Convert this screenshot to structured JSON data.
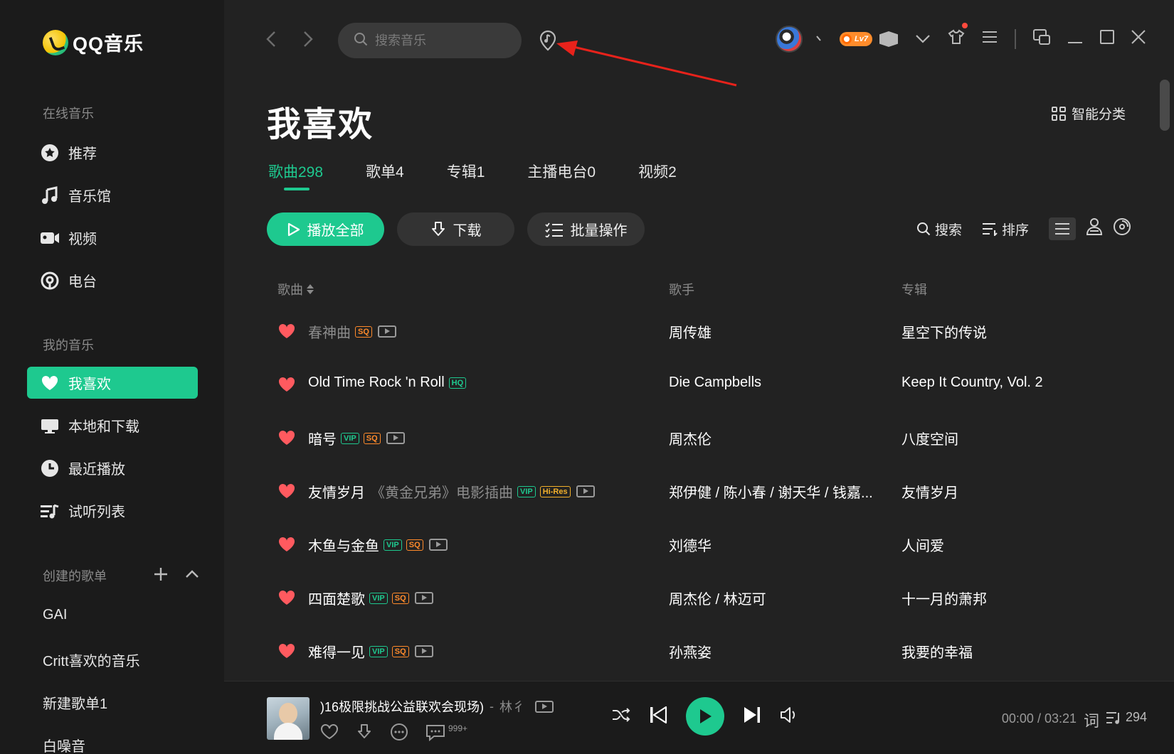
{
  "app": {
    "name": "QQ音乐"
  },
  "sidebar": {
    "online_title": "在线音乐",
    "online_items": [
      {
        "label": "推荐",
        "icon": "star-icon"
      },
      {
        "label": "音乐馆",
        "icon": "music-note-icon"
      },
      {
        "label": "视频",
        "icon": "video-camera-icon"
      },
      {
        "label": "电台",
        "icon": "radio-icon"
      }
    ],
    "my_title": "我的音乐",
    "my_items": [
      {
        "label": "我喜欢",
        "icon": "heart-icon",
        "active": true
      },
      {
        "label": "本地和下载",
        "icon": "monitor-icon"
      },
      {
        "label": "最近播放",
        "icon": "clock-icon"
      },
      {
        "label": "试听列表",
        "icon": "playlist-icon"
      }
    ],
    "created_title": "创建的歌单",
    "playlists": [
      "GAI",
      "Critt喜欢的音乐",
      "新建歌单1",
      "白噪音"
    ]
  },
  "topbar": {
    "search_placeholder": "搜索音乐",
    "level_badge": "Lv7"
  },
  "page": {
    "title": "我喜欢",
    "smart_category": "智能分类",
    "tabs": [
      "歌曲298",
      "歌单4",
      "专辑1",
      "主播电台0",
      "视频2"
    ],
    "active_tab": 0,
    "buttons": {
      "play_all": "播放全部",
      "download": "下载",
      "batch": "批量操作"
    },
    "tools": {
      "search": "搜索",
      "sort": "排序"
    }
  },
  "table": {
    "headers": {
      "song": "歌曲",
      "artist": "歌手",
      "album": "专辑"
    },
    "rows": [
      {
        "title": "春神曲",
        "subtitle": "",
        "tags": [
          "SQ"
        ],
        "mv": true,
        "artist": "周传雄",
        "album": "星空下的传说",
        "dim": true
      },
      {
        "title": "Old Time Rock 'n Roll",
        "subtitle": "",
        "tags": [
          "HQ"
        ],
        "mv": false,
        "artist": "Die Campbells",
        "album": "Keep It Country, Vol. 2",
        "dim": false
      },
      {
        "title": "暗号",
        "subtitle": "",
        "tags": [
          "VIP",
          "SQ"
        ],
        "mv": true,
        "artist": "周杰伦",
        "album": "八度空间",
        "dim": false
      },
      {
        "title": "友情岁月",
        "subtitle": "《黄金兄弟》电影插曲",
        "tags": [
          "VIP",
          "Hi-Res"
        ],
        "mv": true,
        "artist": "郑伊健 / 陈小春 / 谢天华 / 钱嘉...",
        "album": "友情岁月",
        "dim": false
      },
      {
        "title": "木鱼与金鱼",
        "subtitle": "",
        "tags": [
          "VIP",
          "SQ"
        ],
        "mv": true,
        "artist": "刘德华",
        "album": "人间爱",
        "dim": false
      },
      {
        "title": "四面楚歌",
        "subtitle": "",
        "tags": [
          "VIP",
          "SQ"
        ],
        "mv": true,
        "artist": "周杰伦 / 林迈可",
        "album": "十一月的萧邦",
        "dim": false
      },
      {
        "title": "难得一见",
        "subtitle": "",
        "tags": [
          "VIP",
          "SQ"
        ],
        "mv": true,
        "artist": "孙燕姿",
        "album": "我要的幸福",
        "dim": false
      }
    ]
  },
  "player": {
    "song": ")16极限挑战公益联欢会现场)",
    "separator": "-",
    "artist": "林彳",
    "comment_count": "999+",
    "current_time": "00:00",
    "total_time": "03:21",
    "lyric_label": "词",
    "queue_count": "294"
  },
  "colors": {
    "accent": "#1ec98f",
    "heart": "#ff5a5f",
    "sq": "#ff8a2b",
    "hires": "#f2b02b"
  }
}
